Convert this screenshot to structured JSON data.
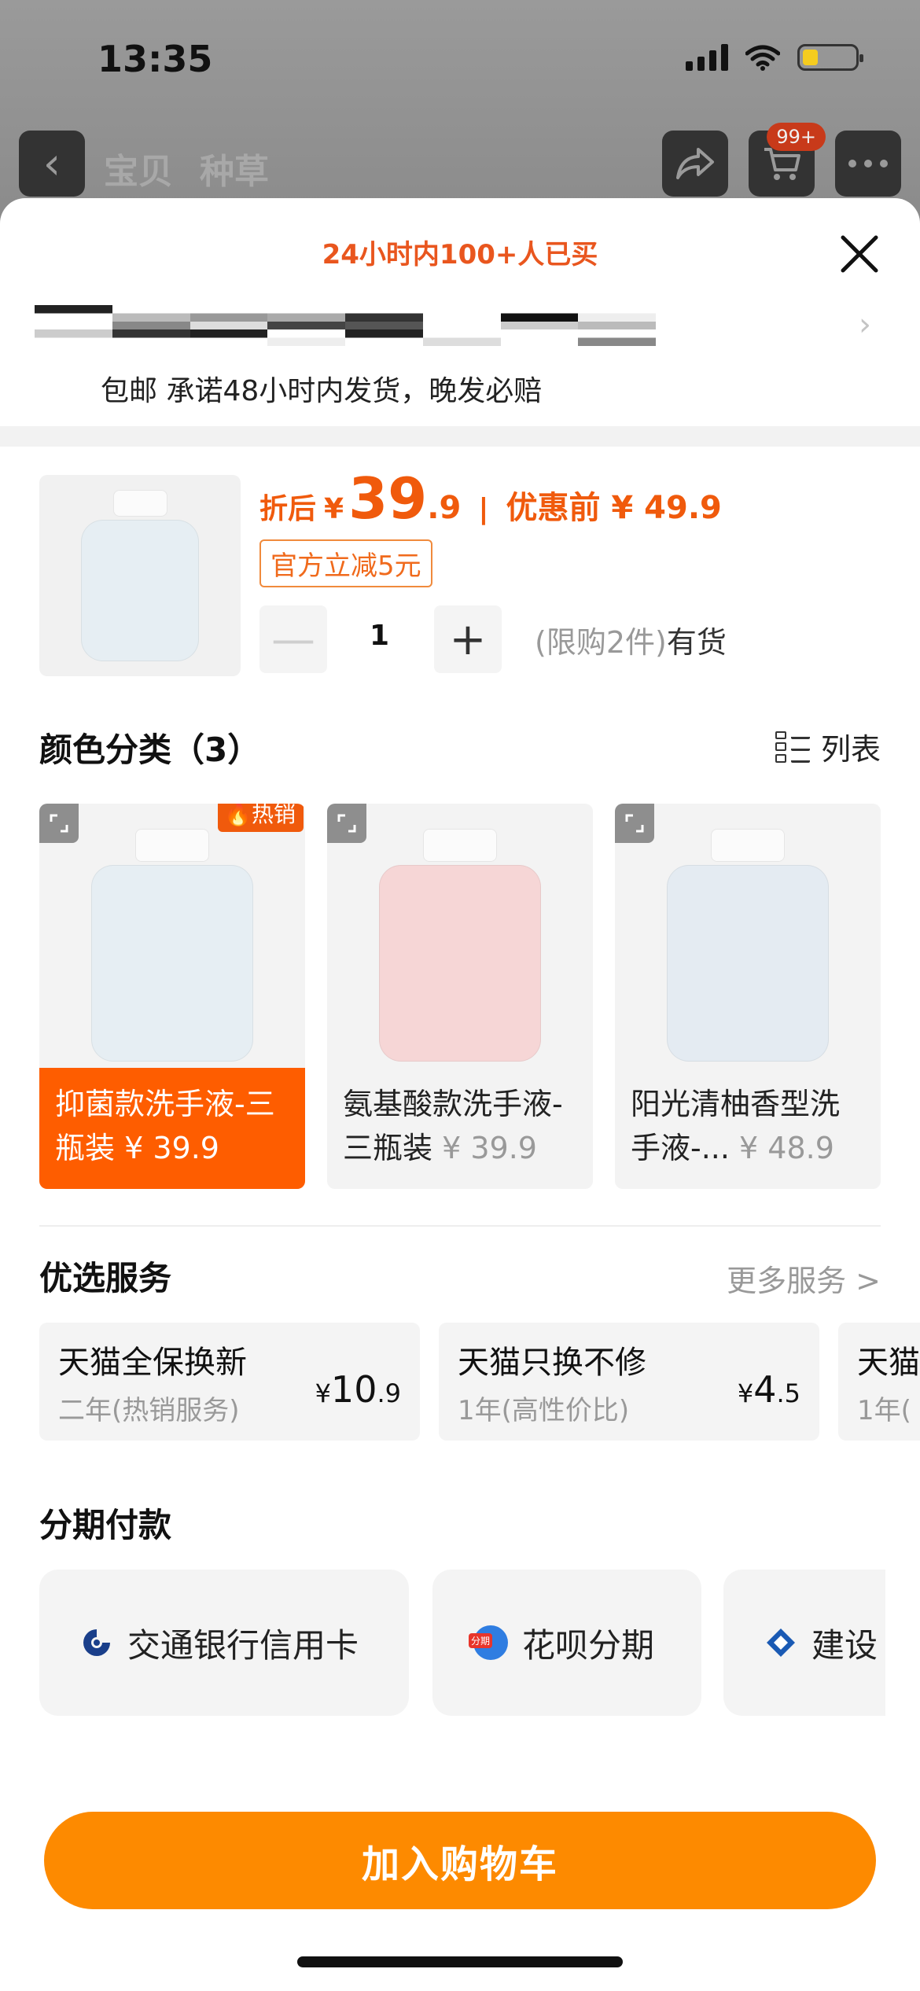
{
  "status_bar": {
    "time": "13:35"
  },
  "nav": {
    "tab_items": [
      "宝贝",
      "种草"
    ],
    "cart_badge": "99+"
  },
  "sheet": {
    "headline": "24小时内100+人已买",
    "shipping": "包邮 承诺48小时内发货，晚发必赔"
  },
  "product": {
    "price_label": "折后",
    "currency": "¥",
    "price_int": "39",
    "price_dec": ".9",
    "separator": "|",
    "orig_label": "优惠前 ¥ 49.9",
    "coupon": "官方立减5元",
    "qty": "1",
    "qty_minus": "—",
    "qty_plus": "+",
    "stock_limit": "(限购2件)",
    "stock_status": "有货"
  },
  "colors": {
    "title": "颜色分类（3）",
    "list_label": "列表",
    "hot_label": "热销",
    "items": [
      {
        "name": "抑菌款洗手液-三瓶装",
        "price": "¥ 39.9",
        "tint": "#e6eef3"
      },
      {
        "name": "氨基酸款洗手液-三瓶装",
        "price": "¥ 39.9",
        "tint": "#f6d6d6"
      },
      {
        "name": "阳光清柚香型洗手液-...",
        "price": "¥ 48.9",
        "tint": "#e4ebf2"
      }
    ]
  },
  "services": {
    "title": "优选服务",
    "more": "更多服务 >",
    "items": [
      {
        "name": "天猫全保换新",
        "desc": "二年(热销服务)",
        "cur": "¥",
        "int": "10",
        "dec": ".9"
      },
      {
        "name": "天猫只换不修",
        "desc": "1年(高性价比)",
        "cur": "¥",
        "int": "4",
        "dec": ".5"
      },
      {
        "name": "天猫",
        "desc": "1年(",
        "cur": "",
        "int": "",
        "dec": ""
      }
    ]
  },
  "installment": {
    "title": "分期付款",
    "items": [
      {
        "name": "交通银行信用卡"
      },
      {
        "name": "花呗分期",
        "icon_text": "分期"
      },
      {
        "name": "建设"
      }
    ]
  },
  "cta": {
    "label": "加入购物车"
  },
  "colors_theme": {
    "accent": "#f05a0c",
    "cta": "#fd8a00",
    "selected": "#fe5d00"
  }
}
